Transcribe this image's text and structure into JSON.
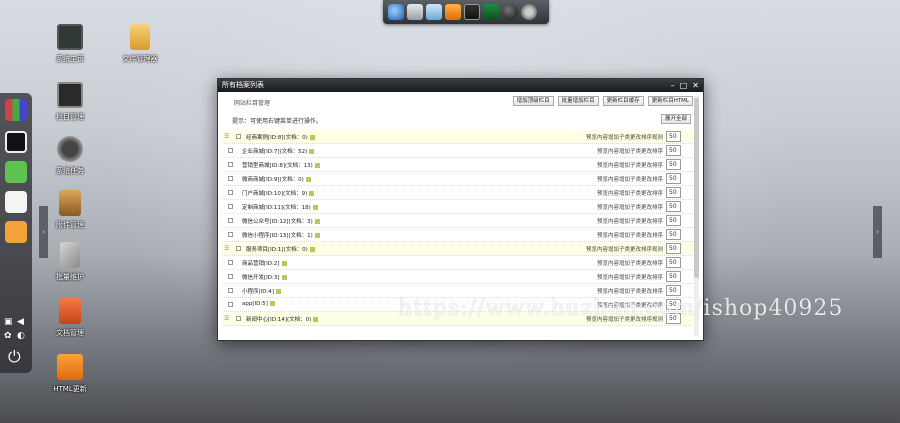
{
  "top_dock": {
    "icons": [
      "globe-icon",
      "network-icon",
      "camera-icon",
      "brush-icon",
      "photo-icon",
      "terminal-icon",
      "ball-icon",
      "gear-icon"
    ]
  },
  "desktop": {
    "icons": [
      {
        "label": "系统主页",
        "icon": "monitor-icon"
      },
      {
        "label": "文件管理器",
        "icon": "folder-icon"
      },
      {
        "label": "栏目管理",
        "icon": "grid-icon"
      },
      {
        "label": "系统任务",
        "icon": "tasks-icon"
      },
      {
        "label": "附件管理",
        "icon": "box-icon"
      },
      {
        "label": "批量维护",
        "icon": "tools-icon"
      },
      {
        "label": "文档管理",
        "icon": "document-icon"
      },
      {
        "label": "HTML更新",
        "icon": "refresh-icon"
      }
    ]
  },
  "window": {
    "title": "所有档案列表",
    "toolbar": {
      "left_label": "网站栏目管理",
      "buttons": [
        "增加顶级栏目",
        "批量增加栏目",
        "更新栏目缓存",
        "更新栏目HTML"
      ]
    },
    "hint": {
      "text": "提示：可使用右键菜单进行操作。",
      "button": "展开全部"
    },
    "sort_note": "预览内容增加子类更改排序规则",
    "rows": [
      {
        "name": "经商案例[ID:8](文档：0)",
        "type": "group",
        "note": "预览内容增加子类更改排序规则",
        "order": "50"
      },
      {
        "name": "企业商城[ID:7](文档：52)",
        "type": "child",
        "note": "预览内容增加子类更改排序",
        "order": "50"
      },
      {
        "name": "营销型商城[ID:8](文档：13)",
        "type": "child",
        "note": "预览内容增加子类更改排序",
        "order": "50"
      },
      {
        "name": "微商商城[ID:9](文档：0)",
        "type": "child",
        "note": "预览内容增加子类更改排序",
        "order": "50"
      },
      {
        "name": "门户商城[ID:10](文档：9)",
        "type": "child",
        "note": "预览内容增加子类更改排序",
        "order": "50"
      },
      {
        "name": "定制商城[ID:11](文档：18)",
        "type": "child",
        "note": "预览内容增加子类更改排序",
        "order": "50"
      },
      {
        "name": "微信公众号[ID:12](文档：3)",
        "type": "child",
        "note": "预览内容增加子类更改排序",
        "order": "50"
      },
      {
        "name": "微信小程序[ID:13](文档：1)",
        "type": "child",
        "note": "预览内容增加子类更改排序",
        "order": "50"
      },
      {
        "name": "服务项目[ID:1](文档：0)",
        "type": "group",
        "note": "预览内容增加子类更改排序规则",
        "order": "50"
      },
      {
        "name": "商品营销[ID:2]",
        "type": "child",
        "note": "预览内容增加子类更改排序",
        "order": "50"
      },
      {
        "name": "微信开发[ID:3]",
        "type": "child",
        "note": "预览内容增加子类更改排序",
        "order": "50"
      },
      {
        "name": "小程序[ID:4]",
        "type": "child",
        "note": "预览内容增加子类更改排序",
        "order": "50"
      },
      {
        "name": "app[ID:5]",
        "type": "child",
        "note": "预览内容增加子类更改排序",
        "order": "50"
      },
      {
        "name": "新闻中心[ID:14](文档：0)",
        "type": "group",
        "note": "预览内容增加子类更改排序规则",
        "order": "50"
      }
    ]
  },
  "watermark": "https://www.huzhan.com/ishop40925"
}
